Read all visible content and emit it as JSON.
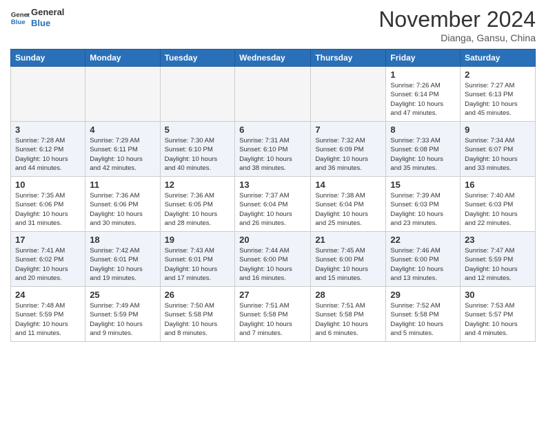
{
  "header": {
    "logo_line1": "General",
    "logo_line2": "Blue",
    "month_title": "November 2024",
    "location": "Dianga, Gansu, China"
  },
  "calendar": {
    "days_of_week": [
      "Sunday",
      "Monday",
      "Tuesday",
      "Wednesday",
      "Thursday",
      "Friday",
      "Saturday"
    ],
    "weeks": [
      [
        {
          "num": "",
          "info": ""
        },
        {
          "num": "",
          "info": ""
        },
        {
          "num": "",
          "info": ""
        },
        {
          "num": "",
          "info": ""
        },
        {
          "num": "",
          "info": ""
        },
        {
          "num": "1",
          "info": "Sunrise: 7:26 AM\nSunset: 6:14 PM\nDaylight: 10 hours\nand 47 minutes."
        },
        {
          "num": "2",
          "info": "Sunrise: 7:27 AM\nSunset: 6:13 PM\nDaylight: 10 hours\nand 45 minutes."
        }
      ],
      [
        {
          "num": "3",
          "info": "Sunrise: 7:28 AM\nSunset: 6:12 PM\nDaylight: 10 hours\nand 44 minutes."
        },
        {
          "num": "4",
          "info": "Sunrise: 7:29 AM\nSunset: 6:11 PM\nDaylight: 10 hours\nand 42 minutes."
        },
        {
          "num": "5",
          "info": "Sunrise: 7:30 AM\nSunset: 6:10 PM\nDaylight: 10 hours\nand 40 minutes."
        },
        {
          "num": "6",
          "info": "Sunrise: 7:31 AM\nSunset: 6:10 PM\nDaylight: 10 hours\nand 38 minutes."
        },
        {
          "num": "7",
          "info": "Sunrise: 7:32 AM\nSunset: 6:09 PM\nDaylight: 10 hours\nand 36 minutes."
        },
        {
          "num": "8",
          "info": "Sunrise: 7:33 AM\nSunset: 6:08 PM\nDaylight: 10 hours\nand 35 minutes."
        },
        {
          "num": "9",
          "info": "Sunrise: 7:34 AM\nSunset: 6:07 PM\nDaylight: 10 hours\nand 33 minutes."
        }
      ],
      [
        {
          "num": "10",
          "info": "Sunrise: 7:35 AM\nSunset: 6:06 PM\nDaylight: 10 hours\nand 31 minutes."
        },
        {
          "num": "11",
          "info": "Sunrise: 7:36 AM\nSunset: 6:06 PM\nDaylight: 10 hours\nand 30 minutes."
        },
        {
          "num": "12",
          "info": "Sunrise: 7:36 AM\nSunset: 6:05 PM\nDaylight: 10 hours\nand 28 minutes."
        },
        {
          "num": "13",
          "info": "Sunrise: 7:37 AM\nSunset: 6:04 PM\nDaylight: 10 hours\nand 26 minutes."
        },
        {
          "num": "14",
          "info": "Sunrise: 7:38 AM\nSunset: 6:04 PM\nDaylight: 10 hours\nand 25 minutes."
        },
        {
          "num": "15",
          "info": "Sunrise: 7:39 AM\nSunset: 6:03 PM\nDaylight: 10 hours\nand 23 minutes."
        },
        {
          "num": "16",
          "info": "Sunrise: 7:40 AM\nSunset: 6:03 PM\nDaylight: 10 hours\nand 22 minutes."
        }
      ],
      [
        {
          "num": "17",
          "info": "Sunrise: 7:41 AM\nSunset: 6:02 PM\nDaylight: 10 hours\nand 20 minutes."
        },
        {
          "num": "18",
          "info": "Sunrise: 7:42 AM\nSunset: 6:01 PM\nDaylight: 10 hours\nand 19 minutes."
        },
        {
          "num": "19",
          "info": "Sunrise: 7:43 AM\nSunset: 6:01 PM\nDaylight: 10 hours\nand 17 minutes."
        },
        {
          "num": "20",
          "info": "Sunrise: 7:44 AM\nSunset: 6:00 PM\nDaylight: 10 hours\nand 16 minutes."
        },
        {
          "num": "21",
          "info": "Sunrise: 7:45 AM\nSunset: 6:00 PM\nDaylight: 10 hours\nand 15 minutes."
        },
        {
          "num": "22",
          "info": "Sunrise: 7:46 AM\nSunset: 6:00 PM\nDaylight: 10 hours\nand 13 minutes."
        },
        {
          "num": "23",
          "info": "Sunrise: 7:47 AM\nSunset: 5:59 PM\nDaylight: 10 hours\nand 12 minutes."
        }
      ],
      [
        {
          "num": "24",
          "info": "Sunrise: 7:48 AM\nSunset: 5:59 PM\nDaylight: 10 hours\nand 11 minutes."
        },
        {
          "num": "25",
          "info": "Sunrise: 7:49 AM\nSunset: 5:59 PM\nDaylight: 10 hours\nand 9 minutes."
        },
        {
          "num": "26",
          "info": "Sunrise: 7:50 AM\nSunset: 5:58 PM\nDaylight: 10 hours\nand 8 minutes."
        },
        {
          "num": "27",
          "info": "Sunrise: 7:51 AM\nSunset: 5:58 PM\nDaylight: 10 hours\nand 7 minutes."
        },
        {
          "num": "28",
          "info": "Sunrise: 7:51 AM\nSunset: 5:58 PM\nDaylight: 10 hours\nand 6 minutes."
        },
        {
          "num": "29",
          "info": "Sunrise: 7:52 AM\nSunset: 5:58 PM\nDaylight: 10 hours\nand 5 minutes."
        },
        {
          "num": "30",
          "info": "Sunrise: 7:53 AM\nSunset: 5:57 PM\nDaylight: 10 hours\nand 4 minutes."
        }
      ]
    ]
  }
}
